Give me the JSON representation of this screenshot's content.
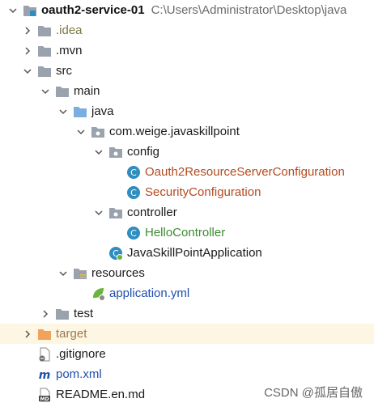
{
  "project": {
    "name": "oauth2-service-01",
    "path": "C:\\Users\\Administrator\\Desktop\\java"
  },
  "nodes": {
    "idea": ".idea",
    "mvn": ".mvn",
    "src": "src",
    "main": "main",
    "java": "java",
    "package": "com.weige.javaskillpoint",
    "config": "config",
    "oauth2_cfg": "Oauth2ResourceServerConfiguration",
    "security_cfg": "SecurityConfiguration",
    "controller": "controller",
    "hello": "HelloController",
    "app": "JavaSkillPointApplication",
    "resources": "resources",
    "app_yml": "application.yml",
    "test": "test",
    "target": "target",
    "gitignore": ".gitignore",
    "pom": "pom.xml",
    "readme": "README.en.md"
  },
  "watermark": "CSDN @孤居自傲",
  "colors": {
    "folder_gray": "#9aa3ad",
    "folder_blue": "#7aaee0",
    "folder_orange": "#f0a35a",
    "class_badge": "#2f8ec0",
    "highlight_row": "#fdf6e3"
  }
}
